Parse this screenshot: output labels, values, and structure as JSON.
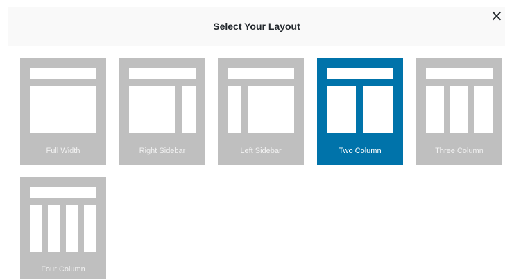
{
  "dialog": {
    "title": "Select Your Layout",
    "close_label": "×"
  },
  "colors": {
    "tile_default": "#bfbfbf",
    "tile_selected": "#0073aa",
    "panel": "#ffffff"
  },
  "layouts": [
    {
      "label": "Full Width",
      "selected": false,
      "icon": "full-width-layout-icon"
    },
    {
      "label": "Right Sidebar",
      "selected": false,
      "icon": "right-sidebar-layout-icon"
    },
    {
      "label": "Left Sidebar",
      "selected": false,
      "icon": "left-sidebar-layout-icon"
    },
    {
      "label": "Two Column",
      "selected": true,
      "icon": "two-column-layout-icon"
    },
    {
      "label": "Three Column",
      "selected": false,
      "icon": "three-column-layout-icon"
    },
    {
      "label": "Four Column",
      "selected": false,
      "icon": "four-column-layout-icon"
    }
  ]
}
